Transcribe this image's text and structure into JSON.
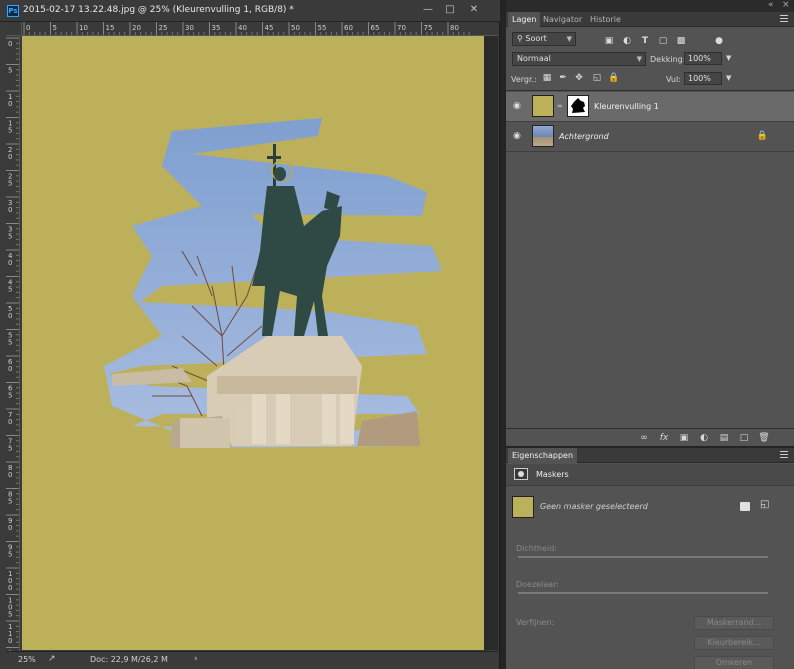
{
  "document": {
    "title": "2015-02-17 13.22.48.jpg @ 25% (Kleurenvulling 1, RGB/8) *",
    "app_icon": "Ps",
    "ruler_top_marks": [
      "0",
      "5",
      "10",
      "15",
      "20",
      "25",
      "30",
      "35",
      "40",
      "45",
      "50",
      "55",
      "60",
      "65",
      "70",
      "75",
      "80"
    ],
    "ruler_left_marks": [
      "0",
      "5",
      "1 0",
      "1 5",
      "2 0",
      "2 5",
      "3 0",
      "3 5",
      "4 0",
      "4 5",
      "5 0",
      "5 5",
      "6 0",
      "6 5",
      "7 0",
      "7 5",
      "8 0",
      "8 5",
      "9 0",
      "9 5",
      "1 0 0",
      "1 0 5",
      "1 1 0",
      "1 1 5"
    ],
    "fill_color": "#bdb05b"
  },
  "statusbar": {
    "zoom": "25%",
    "doc_info": "Doc: 22,9 M/26,2 M",
    "arrow": "›"
  },
  "layers_panel": {
    "tabs": [
      "Lagen",
      "Navigator",
      "Historie"
    ],
    "filter_label": "Soort",
    "blend_mode": "Normaal",
    "opacity_label": "Dekking:",
    "opacity_value": "100%",
    "lock_label": "Vergr.:",
    "fill_label": "Vul:",
    "fill_value": "100%",
    "layers": [
      {
        "name": "Kleurenvulling 1",
        "selected": true,
        "visible": true
      },
      {
        "name": "Achtergrond",
        "selected": false,
        "visible": true,
        "locked": true
      }
    ],
    "bottom_icons": [
      "link-icon",
      "fx-icon",
      "mask-icon",
      "adjustment-icon",
      "folder-icon",
      "new-layer-icon",
      "trash-icon"
    ]
  },
  "properties_panel": {
    "tab": "Eigenschappen",
    "section": "Maskers",
    "status": "Geen masker geselecteerd",
    "density_label": "Dichtheid:",
    "feather_label": "Doezelaar:",
    "refine_label": "Verfijnen:",
    "buttons": [
      "Maskerrand...",
      "Kleurbereik...",
      "Omkeren"
    ]
  }
}
